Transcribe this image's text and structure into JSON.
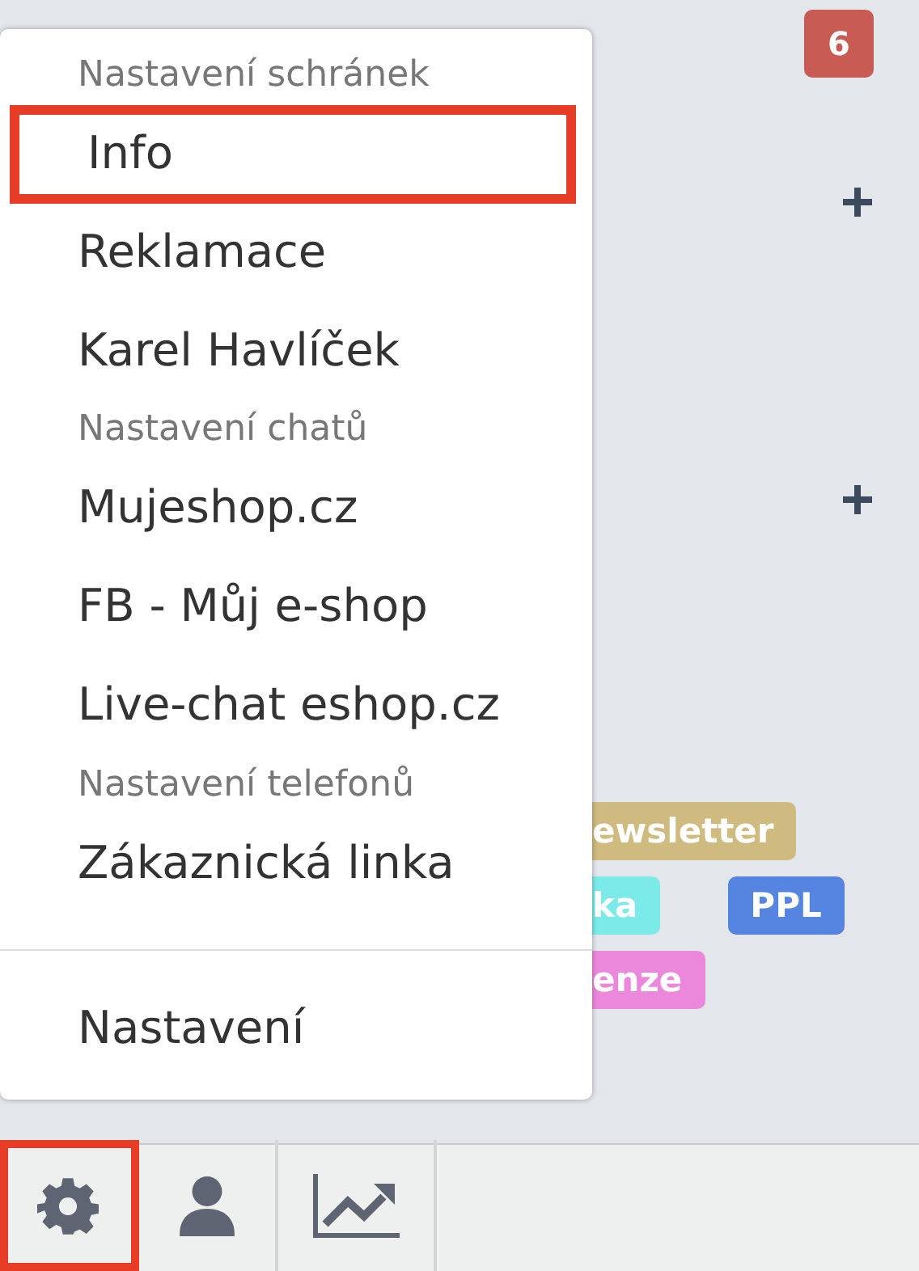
{
  "badge": "6",
  "add_buttons": [
    {
      "kind": "plus"
    },
    {
      "kind": "plus"
    }
  ],
  "tags": [
    {
      "label": "ewsletter",
      "color": "#cfbb80"
    },
    {
      "label": "ka",
      "color": "#7deaea"
    },
    {
      "label": "PPL",
      "color": "#5585e0"
    },
    {
      "label": "enze",
      "color": "#ec88dc"
    }
  ],
  "menu": {
    "items": [
      {
        "kind": "header",
        "label": "Nastavení schránek"
      },
      {
        "kind": "item",
        "label": "Info",
        "selected": true
      },
      {
        "kind": "item",
        "label": "Reklamace",
        "selected": false
      },
      {
        "kind": "item",
        "label": "Karel Havlíček",
        "selected": false
      },
      {
        "kind": "header",
        "label": "Nastavení chatů"
      },
      {
        "kind": "item",
        "label": "Mujeshop.cz",
        "selected": false
      },
      {
        "kind": "item",
        "label": "FB - Můj e-shop",
        "selected": false
      },
      {
        "kind": "item",
        "label": "Live-chat eshop.cz",
        "selected": false
      },
      {
        "kind": "header",
        "label": "Nastavení telefonů"
      },
      {
        "kind": "item",
        "label": "Zákaznická linka",
        "selected": false
      },
      {
        "kind": "divider"
      },
      {
        "kind": "item",
        "label": "Nastavení",
        "selected": false
      }
    ]
  },
  "toolbar": [
    {
      "kind": "settings",
      "selected": true
    },
    {
      "kind": "user",
      "selected": false
    },
    {
      "kind": "chart",
      "selected": false
    }
  ]
}
